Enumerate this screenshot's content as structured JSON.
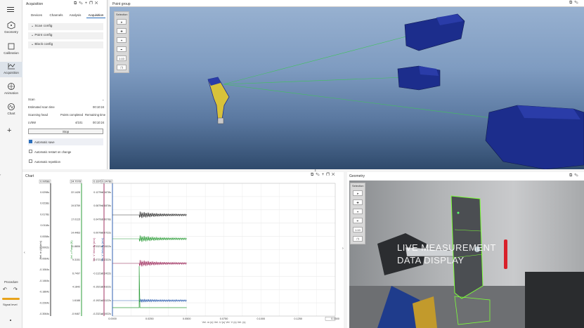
{
  "rail": {
    "menu_icon": "menu-icon",
    "items": [
      {
        "label": "Geometry",
        "icon": "geometry-icon"
      },
      {
        "label": "Calibration",
        "icon": "calibration-icon"
      },
      {
        "label": "Acquisition",
        "icon": "acquisition-icon"
      },
      {
        "label": "Animation",
        "icon": "animation-icon"
      },
      {
        "label": "Chart",
        "icon": "chart-icon"
      }
    ],
    "add_icon": "plus-icon",
    "procedure_label": "Procedure",
    "signal_level_label": "Signal level"
  },
  "acquisition": {
    "title": "Acquisition",
    "tabs": [
      "Devices",
      "Channels",
      "Analysis",
      "Acquisition"
    ],
    "sections": [
      "Scan config",
      "Point config",
      "Block config"
    ],
    "scan_label": "Scan",
    "estimated_label": "Estimated scan time",
    "estimated_value": "00:10:24",
    "scanning_head_label": "Scanning head",
    "points_completed_label": "Points completed",
    "remaining_label": "Remaining time",
    "device_name": "LV5W",
    "points_value": "4/101",
    "remaining_value": "00:10:24",
    "stop_label": "Stop",
    "checkboxes": [
      {
        "label": "Automatic save",
        "checked": true
      },
      {
        "label": "Automatic restart on change",
        "checked": false
      },
      {
        "label": "Automatic repetition",
        "checked": false
      }
    ]
  },
  "pointgroup": {
    "title": "Point group",
    "selection_label": "Selection",
    "zoom_value": "1:10"
  },
  "chart": {
    "title": "Chart",
    "axes": [
      {
        "top": "0.9958s",
        "label": "Vel. m (s) (m/s)",
        "color": "#333333",
        "ticks": [
          "0.0298s",
          "0.0238s",
          "0.0178s",
          "0.0118s",
          "0.0058s",
          "-0.0002s",
          "-0.0064s",
          "-0.1064s",
          "-0.1464s",
          "-0.1864s",
          "-0.2264s",
          "-0.3064s"
        ]
      },
      {
        "top": "24.7078",
        "label": "Vel. z Force (N)",
        "color": "#2e9e3a",
        "ticks": [
          "22.1428",
          "19.5759",
          "17.0115",
          "14.4463",
          "11.8806",
          "9.3151",
          "6.7497",
          "4.1842",
          "1.6188",
          "-0.9467"
        ]
      },
      {
        "top": "0.1679s",
        "label": "Vel. V Velocity (m/s)",
        "color": "#a03060",
        "ticks": [
          "0.1279s",
          "0.0879s",
          "0.0479s",
          "0.0079s",
          "-0.0321s",
          "-0.0721s",
          "-0.1121s",
          "-0.1521s",
          "-0.1921s",
          "-0.2321s"
        ]
      },
      {
        "top": "0.2478s",
        "label": "Vel. V Velocity (m/s)",
        "color": "#3060b0",
        "ticks": [
          "0.1678s",
          "0.0878s",
          "0.0078s",
          "-0.0722s",
          "-0.1522s",
          "-0.2322s",
          "-0.2422s",
          "-0.0322s",
          "-0.1122s",
          "-0.1922s"
        ]
      }
    ],
    "x_ticks": [
      "0.0000",
      "0.0250",
      "0.0500",
      "0.0750",
      "0.1000",
      "0.1250",
      "0.1500"
    ],
    "x_end": "0.1500",
    "legend": "Vel. m (s) Vel. U (s) Vel. V (s) Vel. (s)"
  },
  "chart_data": {
    "type": "line",
    "x": [
      0,
      0.015,
      0.018,
      0.025,
      0.05
    ],
    "xlim": [
      0,
      0.15
    ],
    "series": [
      {
        "name": "Vel. m",
        "values": [
          0,
          0,
          0.4,
          0.2,
          0.22
        ],
        "color": "#333333"
      },
      {
        "name": "Vel. U",
        "values": [
          0,
          0,
          0.55,
          0.45,
          0.46
        ],
        "color": "#2e9e3a"
      },
      {
        "name": "Vel. V",
        "values": [
          0,
          0,
          0.5,
          0.37,
          0.38
        ],
        "color": "#a03060"
      },
      {
        "name": "Vel.",
        "values": [
          0,
          0,
          0.62,
          0.55,
          0.55
        ],
        "color": "#3060b0"
      }
    ]
  },
  "geometry": {
    "title": "Geometry",
    "selection_label": "Selection",
    "zoom_value": "1:10",
    "overlay_line1": "LIVE MEASUREMENT",
    "overlay_line2": "DATA DISPLAY"
  }
}
